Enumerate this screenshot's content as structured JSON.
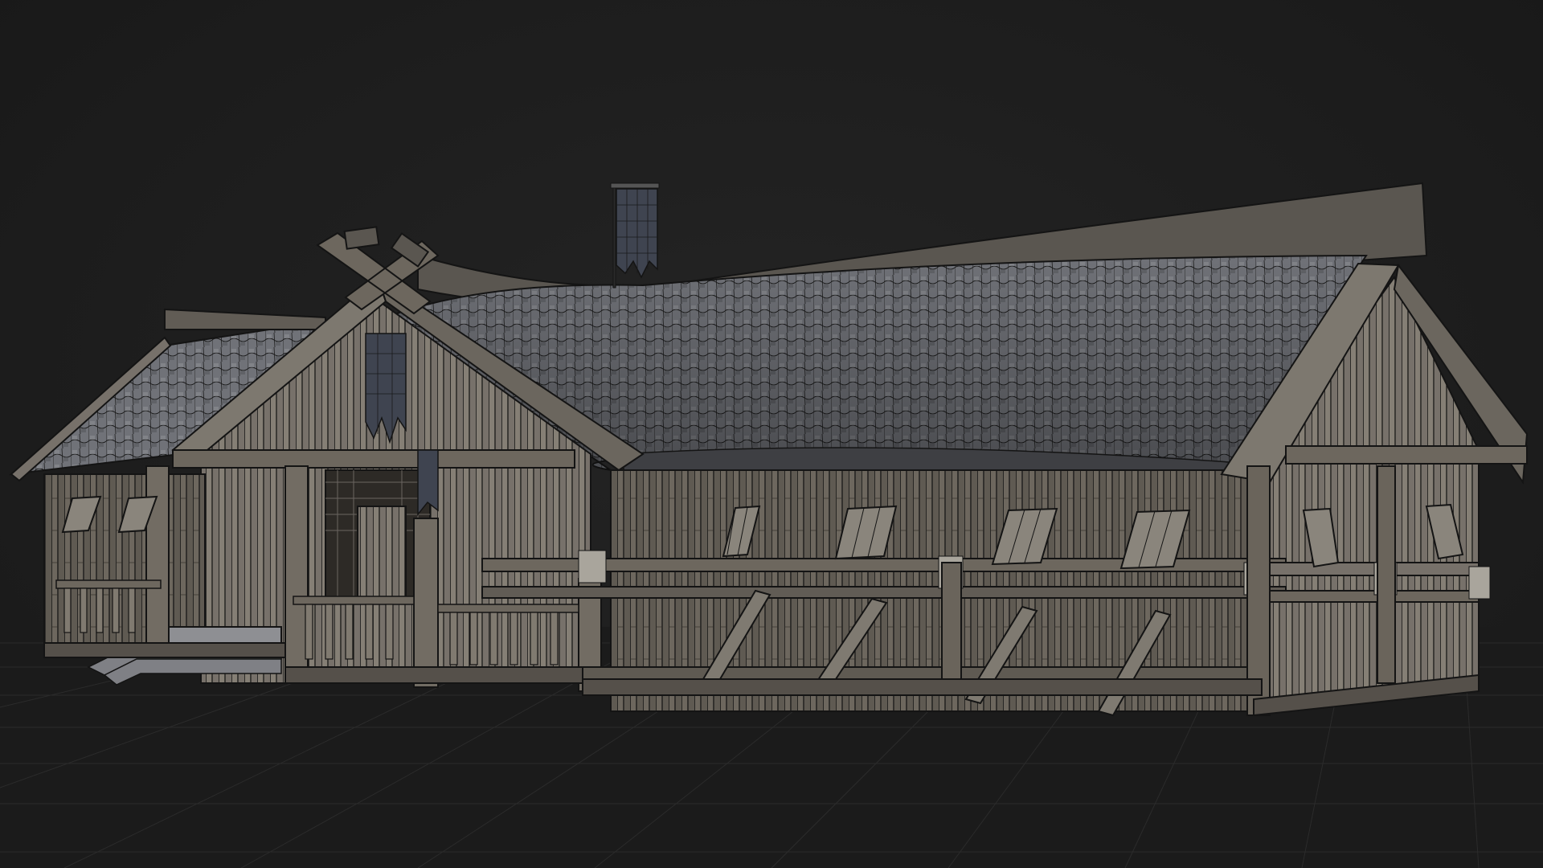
{
  "viewport": {
    "background_color": "#1e1e1e",
    "grid_color": "#2c2c2c",
    "view": "3d-perspective",
    "shading": "textured-wireframe-overlay"
  },
  "scene": {
    "object": "longhouse-3d-model",
    "colors": {
      "wood_light": "#8a8478",
      "wood_mid": "#5f5a52",
      "wood_dark": "#3a3631",
      "thatch_light": "#8c8e93",
      "thatch_dark": "#4b4c50",
      "wire": "#141414"
    }
  }
}
